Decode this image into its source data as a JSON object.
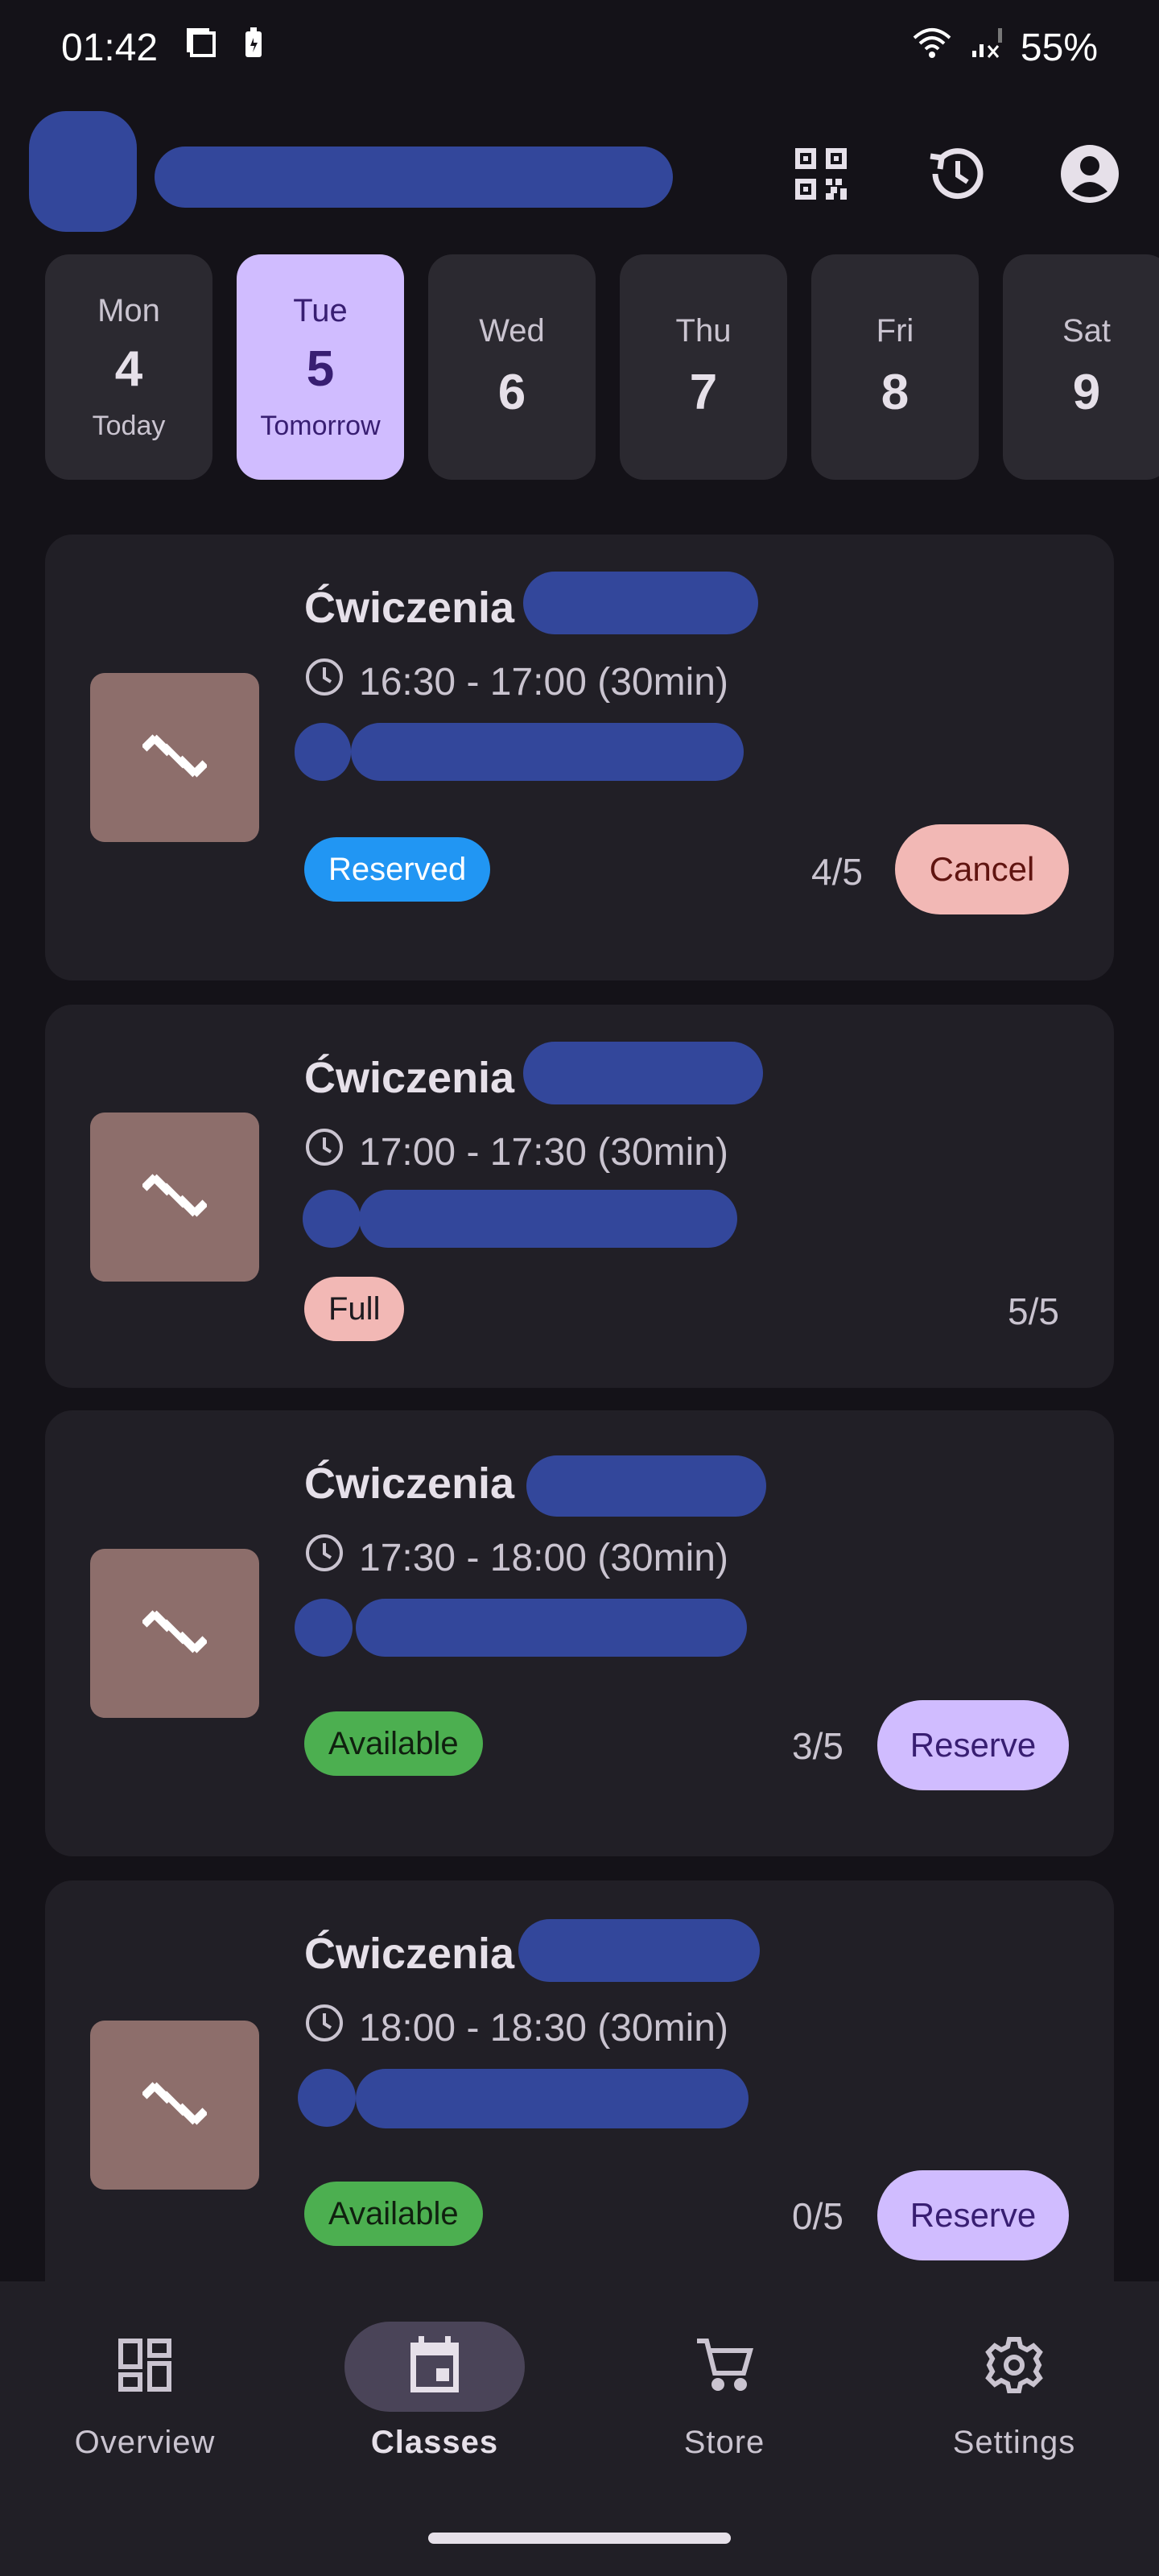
{
  "status_bar": {
    "time": "01:42",
    "battery": "55%"
  },
  "app_bar": {
    "icons": [
      "qr-code-icon",
      "history-icon",
      "account-icon"
    ]
  },
  "days": [
    {
      "name": "Mon",
      "num": "4",
      "sub": "Today",
      "selected": false
    },
    {
      "name": "Tue",
      "num": "5",
      "sub": "Tomorrow",
      "selected": true
    },
    {
      "name": "Wed",
      "num": "6",
      "sub": "",
      "selected": false
    },
    {
      "name": "Thu",
      "num": "7",
      "sub": "",
      "selected": false
    },
    {
      "name": "Fri",
      "num": "8",
      "sub": "",
      "selected": false
    },
    {
      "name": "Sat",
      "num": "9",
      "sub": "",
      "selected": false
    }
  ],
  "classes": [
    {
      "title": "Ćwiczenia",
      "time": "16:30 - 17:00 (30min)",
      "badge": "Reserved",
      "count": "4/5",
      "action": "Cancel"
    },
    {
      "title": "Ćwiczenia",
      "time": "17:00 - 17:30 (30min)",
      "badge": "Full",
      "count": "5/5",
      "action": ""
    },
    {
      "title": "Ćwiczenia",
      "time": "17:30 - 18:00 (30min)",
      "badge": "Available",
      "count": "3/5",
      "action": "Reserve"
    },
    {
      "title": "Ćwiczenia",
      "time": "18:00 - 18:30 (30min)",
      "badge": "Available",
      "count": "0/5",
      "action": "Reserve"
    }
  ],
  "nav": [
    {
      "label": "Overview",
      "icon": "dashboard-icon",
      "active": false
    },
    {
      "label": "Classes",
      "icon": "calendar-icon",
      "active": true
    },
    {
      "label": "Store",
      "icon": "cart-icon",
      "active": false
    },
    {
      "label": "Settings",
      "icon": "gear-icon",
      "active": false
    }
  ],
  "colors": {
    "background": "#141218",
    "card": "#211F26",
    "accent": "#D0BCFF",
    "reserved": "#2196F3",
    "available": "#4CAF50",
    "full": "#F2B8B5",
    "redaction": "#33479B"
  }
}
